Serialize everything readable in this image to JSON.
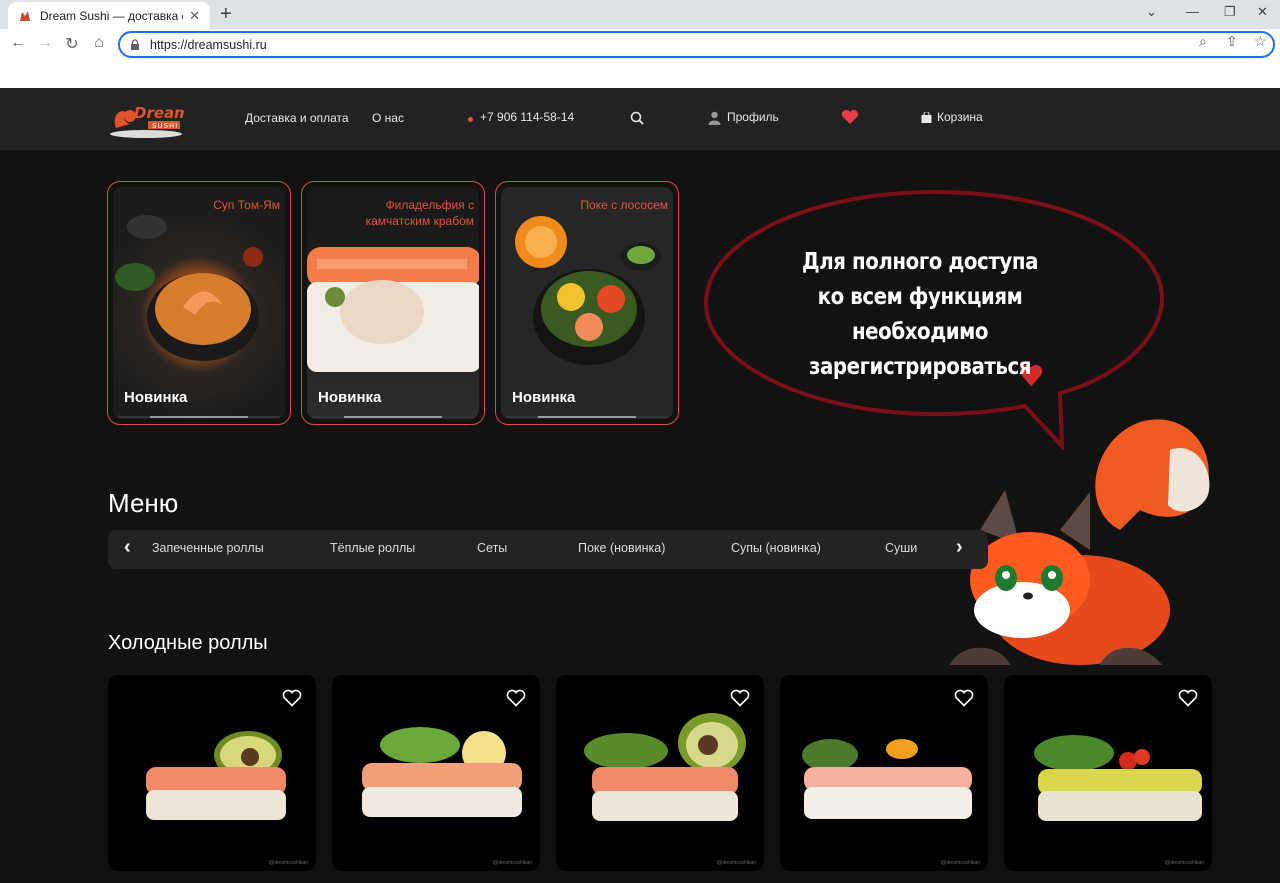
{
  "browser": {
    "tab_title": "Dream Sushi — доставка суши, р",
    "url": "https://dreamsushi.ru"
  },
  "header": {
    "logo_text": "Dream",
    "logo_sub": "SUSHI",
    "nav": [
      "Доставка и оплата",
      "О нас"
    ],
    "phone": "+7 906 114-58-14",
    "profile": "Профиль",
    "cart": "Корзина"
  },
  "promos": [
    {
      "caption": "Суп Том-Ям",
      "badge": "Новинка"
    },
    {
      "caption": "Филадельфия с камчатским крабом",
      "badge": "Новинка"
    },
    {
      "caption": "Поке с лососем",
      "badge": "Новинка"
    }
  ],
  "bubble": {
    "lines": [
      "Для полного доступа",
      "ко всем функциям",
      "необходимо зарегистрироваться"
    ]
  },
  "menu": {
    "title": "Меню",
    "categories": [
      "Запеченные роллы",
      "Тёплые роллы",
      "Сеты",
      "Поке (новинка)",
      "Супы (новинка)",
      "Суши"
    ]
  },
  "section": {
    "title": "Холодные роллы",
    "watermark": "@dreamsushikan"
  },
  "colors": {
    "accent": "#e0543f",
    "heart": "#e83a4a",
    "bubble_border": "#7a0f17"
  }
}
